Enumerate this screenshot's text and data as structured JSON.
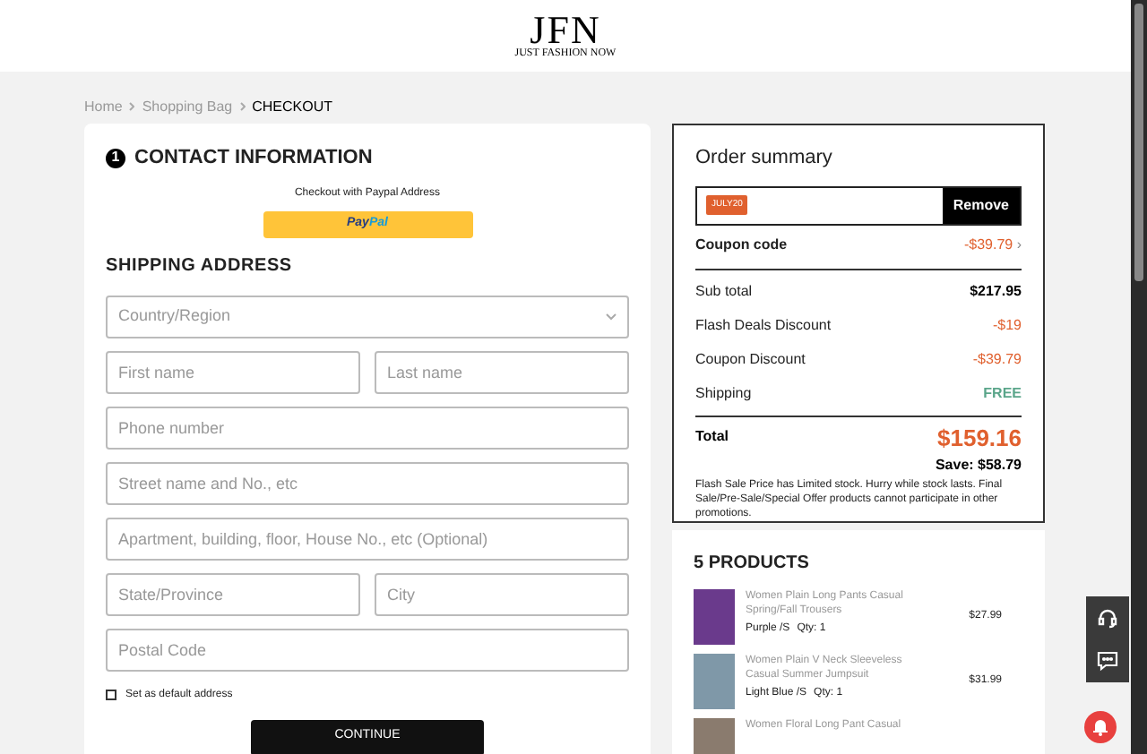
{
  "header": {
    "logo": "JFN",
    "tagline": "JUST FASHION NOW"
  },
  "breadcrumb": [
    {
      "label": "Home",
      "current": false
    },
    {
      "label": "Shopping Bag",
      "current": false
    },
    {
      "label": "CHECKOUT",
      "current": true
    }
  ],
  "contact": {
    "step": "1",
    "title": "CONTACT INFORMATION",
    "paypal_note": "Checkout with Paypal Address",
    "paypal_button": {
      "pay": "Pay",
      "pal": "Pal"
    }
  },
  "shipping": {
    "title": "SHIPPING ADDRESS",
    "rows": [
      [
        {
          "kind": "select",
          "placeholder": "Country/Region"
        }
      ],
      [
        {
          "kind": "text",
          "placeholder": "First name"
        },
        {
          "kind": "text",
          "placeholder": "Last name"
        }
      ],
      [
        {
          "kind": "text",
          "placeholder": "Phone number"
        }
      ],
      [
        {
          "kind": "text",
          "placeholder": "Street name and No., etc"
        }
      ],
      [
        {
          "kind": "text",
          "placeholder": "Apartment, building, floor, House No., etc (Optional)"
        }
      ],
      [
        {
          "kind": "text",
          "placeholder": "State/Province"
        },
        {
          "kind": "text",
          "placeholder": "City"
        }
      ],
      [
        {
          "kind": "text",
          "placeholder": "Postal Code"
        }
      ]
    ],
    "default_address": {
      "label": "Set as default address",
      "checked": false
    },
    "continue": "CONTINUE"
  },
  "order_summary": {
    "title": "Order summary",
    "coupon_tag": "JULY20",
    "remove": "Remove",
    "coupon_label": "Coupon code",
    "coupon_value": "-$39.79",
    "chevron": "›",
    "lines": [
      {
        "label": "Sub total",
        "value": "$217.95",
        "kind": "plain"
      },
      {
        "label": "Flash Deals Discount",
        "value": "-$19",
        "kind": "discount"
      },
      {
        "label": "Coupon Discount",
        "value": "-$39.79",
        "kind": "discount"
      },
      {
        "label": "Shipping",
        "value": "FREE",
        "kind": "free"
      }
    ],
    "total_label": "Total",
    "total": "$159.16",
    "save": "Save: $58.79",
    "note": "Flash Sale Price has Limited stock. Hurry while stock lasts. Final Sale/Pre-Sale/Special Offer products cannot participate in other promotions."
  },
  "products": {
    "title": "5 PRODUCTS",
    "items": [
      {
        "name": "Women Plain Long Pants Casual Spring/Fall Trousers",
        "variant": "Purple /S",
        "qty": "Qty: 1",
        "price": "$27.99",
        "color": "#6a3a8c"
      },
      {
        "name": "Women Plain V Neck Sleeveless Casual Summer Jumpsuit",
        "variant": "Light Blue /S",
        "qty": "Qty: 1",
        "price": "$31.99",
        "color": "#7f98a8"
      },
      {
        "name": "Women Floral Long Pant Casual",
        "color": "#8a7b6e"
      }
    ]
  }
}
